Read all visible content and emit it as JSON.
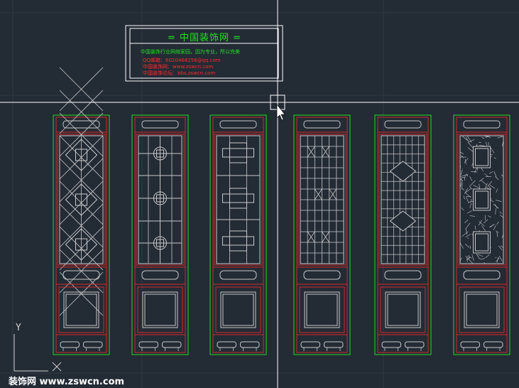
{
  "title_block": {
    "heading": "=    中国装饰网    =",
    "line1": "中国装饰行业网络家园，因为专业，所以完美",
    "line2": "QQ邮箱：6020468256@qq.com",
    "line3": "中国装饰网：www.zswcn.com",
    "line4": "中国装饰论坛：bbs.zswcn.com"
  },
  "ucs": {
    "y_label": "Y",
    "x_label": "X"
  },
  "watermark": "装饰网 www.zswcn.com",
  "colors": {
    "background": "#232b35",
    "frame_green": "#22dd22",
    "rail_red": "#d02828",
    "lattice_gray": "#c8c8c8",
    "crosshair": "#ffffff",
    "title_green": "#22e022",
    "title_red": "#ff2a2a"
  },
  "doors": [
    {
      "name": "door-panel-1",
      "pattern": "lattice-diamond-knots"
    },
    {
      "name": "door-panel-2",
      "pattern": "lattice-cross-flowers"
    },
    {
      "name": "door-panel-3",
      "pattern": "lattice-stepped-frames"
    },
    {
      "name": "door-panel-4",
      "pattern": "lattice-grid-x"
    },
    {
      "name": "door-panel-5",
      "pattern": "lattice-grid-dense"
    },
    {
      "name": "door-panel-6",
      "pattern": "lattice-ice-crack"
    }
  ]
}
